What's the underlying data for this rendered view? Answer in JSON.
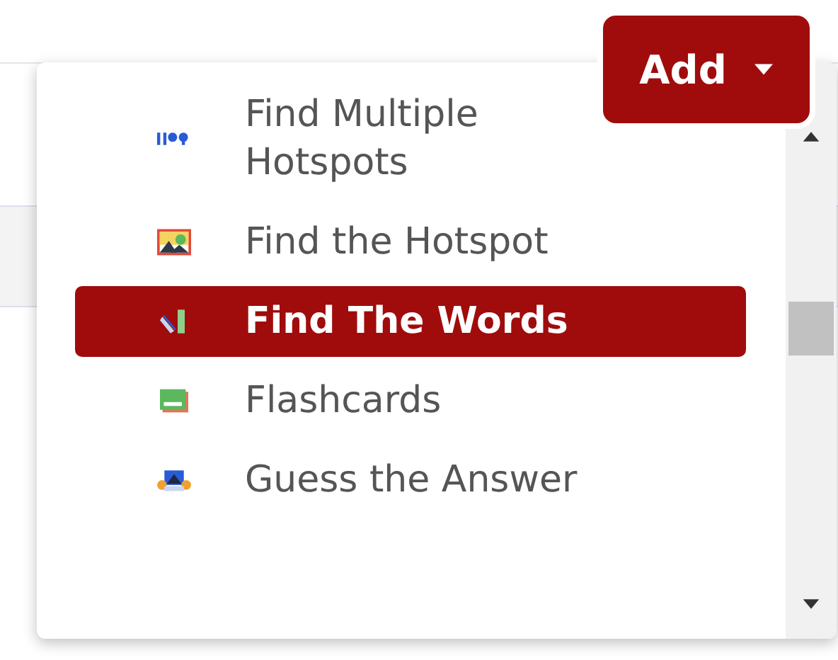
{
  "add_button": {
    "label": "Add"
  },
  "menu": {
    "items": [
      {
        "label": "Find Multiple Hotspots",
        "kind": "hotspots",
        "selected": false
      },
      {
        "label": "Find the Hotspot",
        "kind": "image",
        "selected": false
      },
      {
        "label": "Find The Words",
        "kind": "words",
        "selected": true
      },
      {
        "label": "Flashcards",
        "kind": "cards",
        "selected": false
      },
      {
        "label": "Guess the Answer",
        "kind": "answer",
        "selected": false
      }
    ]
  }
}
